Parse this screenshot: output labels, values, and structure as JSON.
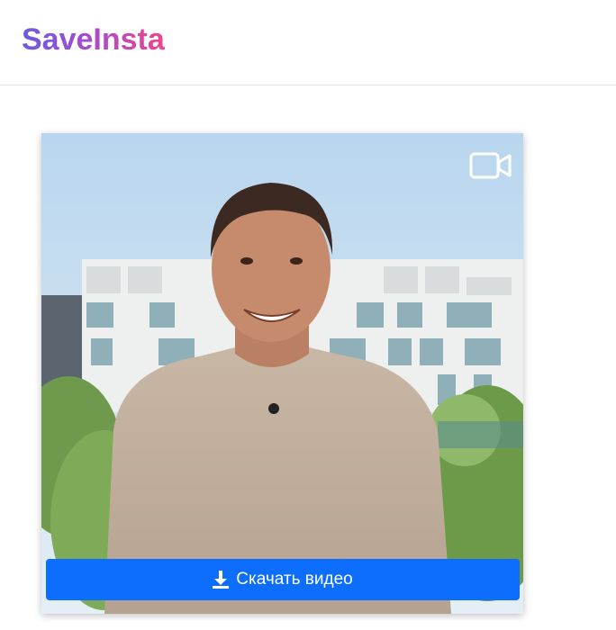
{
  "header": {
    "logo_text": "SaveInsta"
  },
  "post": {
    "media_type_icon": "video-camera-icon",
    "media_description_icon": "person-smiling-photo",
    "download_button": {
      "label": "Скачать видео",
      "icon": "download-icon",
      "color": "#0d6efd"
    }
  },
  "colors": {
    "logo_gradient_start": "#6b5bdf",
    "logo_gradient_end": "#f0458e",
    "accent": "#0d6efd"
  }
}
